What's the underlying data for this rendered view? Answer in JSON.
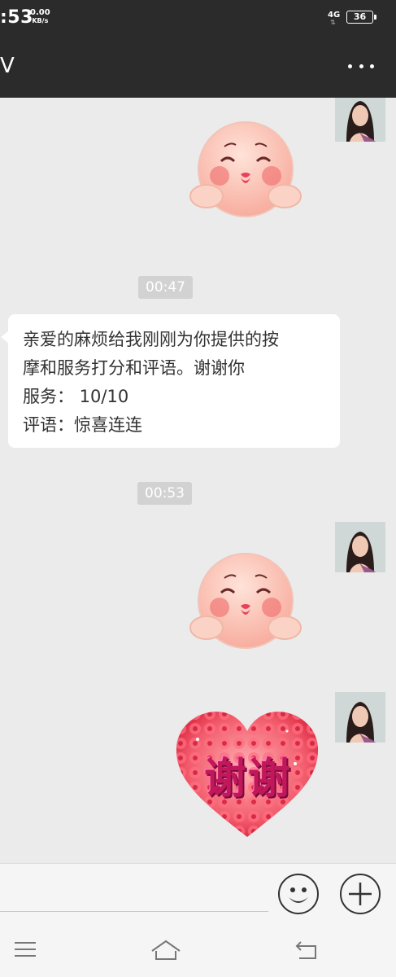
{
  "status_bar": {
    "time": ":53",
    "net_speed": "0.00",
    "net_speed_unit": "KB/s",
    "network": "4G",
    "battery": "36"
  },
  "header": {
    "title": "V",
    "more_icon": "more-icon"
  },
  "messages": {
    "timestamp_1": "00:47",
    "timestamp_2": "00:53",
    "text_lines": [
      "亲爱的麻烦给我刚刚为你提供的按",
      "摩和服务打分和评语。谢谢你",
      "服务：  10/10",
      "评语：惊喜连连"
    ],
    "sticker_heart_text": "谢谢"
  },
  "input_bar": {
    "emoji_icon": "emoji-icon",
    "plus_icon": "plus-icon"
  },
  "nav_bar": {
    "menu_icon": "menu-icon",
    "home_icon": "home-icon",
    "back_icon": "back-icon"
  },
  "colors": {
    "header_bg": "#2b2b2b",
    "chat_bg": "#ebebeb",
    "timestamp_bg": "#d2d2d2",
    "bubble_bg": "#ffffff"
  }
}
